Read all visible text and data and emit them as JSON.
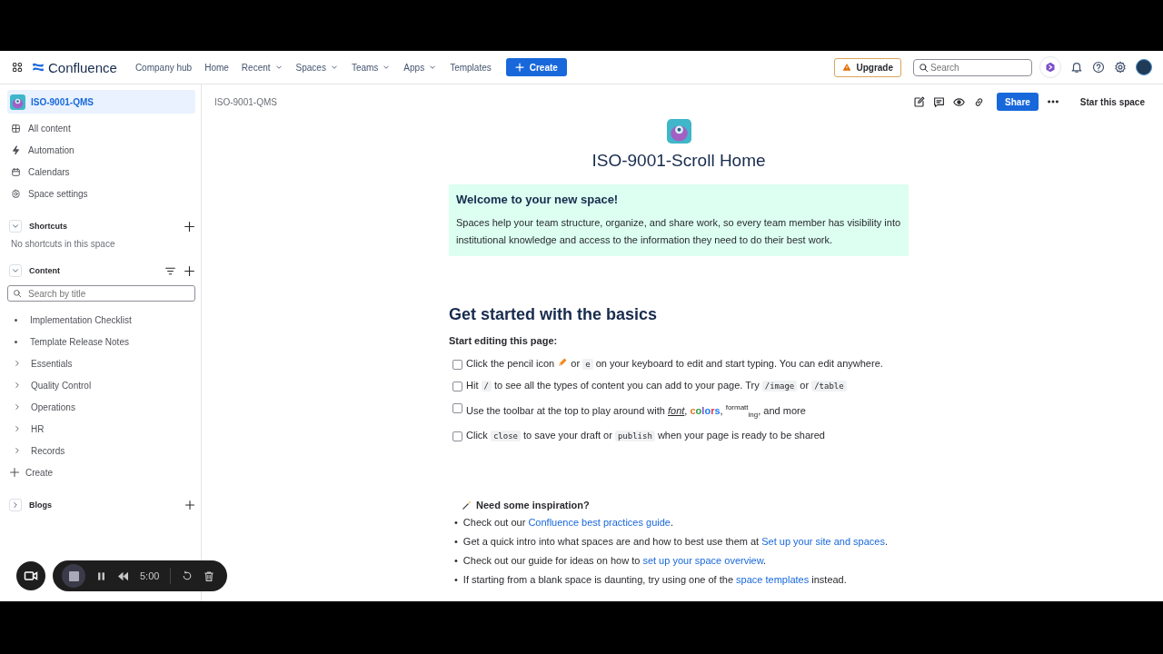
{
  "header": {
    "app_name": "Confluence",
    "nav": [
      {
        "label": "Company hub",
        "dropdown": false
      },
      {
        "label": "Home",
        "dropdown": false
      },
      {
        "label": "Recent",
        "dropdown": true
      },
      {
        "label": "Spaces",
        "dropdown": true
      },
      {
        "label": "Teams",
        "dropdown": true
      },
      {
        "label": "Apps",
        "dropdown": true
      },
      {
        "label": "Templates",
        "dropdown": false
      }
    ],
    "create_label": "Create",
    "upgrade_label": "Upgrade",
    "search_placeholder": "Search"
  },
  "sidebar": {
    "space_name": "ISO-9001-QMS",
    "items": [
      {
        "label": "All content",
        "kind": "grid"
      },
      {
        "label": "Automation",
        "kind": "bolt"
      },
      {
        "label": "Calendars",
        "kind": "calendar"
      },
      {
        "label": "Space settings",
        "kind": "gear"
      }
    ],
    "shortcuts": {
      "title": "Shortcuts",
      "expanded": true,
      "empty_text": "No shortcuts in this space"
    },
    "content": {
      "title": "Content",
      "expanded": true,
      "search_placeholder": "Search by title",
      "items": [
        {
          "label": "Implementation Checklist",
          "kind": "page"
        },
        {
          "label": "Template Release Notes",
          "kind": "page"
        },
        {
          "label": "Essentials",
          "kind": "folder"
        },
        {
          "label": "Quality Control",
          "kind": "folder"
        },
        {
          "label": "Operations",
          "kind": "folder"
        },
        {
          "label": "HR",
          "kind": "folder"
        },
        {
          "label": "Records",
          "kind": "folder"
        }
      ],
      "create_label": "Create"
    },
    "blogs": {
      "title": "Blogs",
      "expanded": false
    }
  },
  "page": {
    "breadcrumb": "ISO-9001-QMS",
    "share_label": "Share",
    "star_label": "Star this space",
    "title": "ISO-9001-Scroll Home",
    "welcome": {
      "title": "Welcome to your new space!",
      "body": "Spaces help your team structure, organize, and share work, so every team member has visibility into institutional knowledge and access to the information they need to do their best work."
    },
    "heading": "Get started with the basics",
    "subheading": "Start editing this page:",
    "tasks": [
      {
        "checked": false,
        "segments": [
          {
            "kind": "text",
            "text": "Click the pencil icon "
          },
          {
            "kind": "pencil"
          },
          {
            "kind": "text",
            "text": " or "
          },
          {
            "kind": "code",
            "text": "e"
          },
          {
            "kind": "text",
            "text": " on your keyboard to edit and start typing. You can edit anywhere."
          }
        ]
      },
      {
        "checked": false,
        "segments": [
          {
            "kind": "text",
            "text": "Hit "
          },
          {
            "kind": "code",
            "text": "/"
          },
          {
            "kind": "text",
            "text": " to see all the types of content you can add to your page. Try "
          },
          {
            "kind": "code",
            "text": "/image"
          },
          {
            "kind": "text",
            "text": " or "
          },
          {
            "kind": "code",
            "text": "/table"
          }
        ]
      },
      {
        "checked": false,
        "segments": [
          {
            "kind": "text",
            "text": "Use the toolbar at the top to play around with "
          },
          {
            "kind": "italic",
            "text": "font"
          },
          {
            "kind": "text",
            "text": ", "
          },
          {
            "kind": "rainbow",
            "text": "colors"
          },
          {
            "kind": "text",
            "text": ", "
          },
          {
            "kind": "sup",
            "text": "formatt"
          },
          {
            "kind": "sub",
            "text": "ing"
          },
          {
            "kind": "text",
            "text": ", and more"
          }
        ]
      },
      {
        "checked": false,
        "segments": [
          {
            "kind": "text",
            "text": "Click "
          },
          {
            "kind": "code",
            "text": "close"
          },
          {
            "kind": "text",
            "text": " to save your draft or "
          },
          {
            "kind": "code",
            "text": "publish"
          },
          {
            "kind": "text",
            "text": " when your page is ready to be shared"
          }
        ]
      }
    ],
    "inspiration_title": "Need some inspiration?",
    "bullets": [
      {
        "marker": "•",
        "segments": [
          {
            "kind": "text",
            "text": "Check out our "
          },
          {
            "kind": "link",
            "text": "Confluence best practices guide"
          },
          {
            "kind": "text",
            "text": "."
          }
        ]
      },
      {
        "marker": "•",
        "segments": [
          {
            "kind": "text",
            "text": "Get a quick intro into what spaces are and how to best use them at "
          },
          {
            "kind": "link",
            "text": "Set up your site and spaces"
          },
          {
            "kind": "text",
            "text": "."
          }
        ]
      },
      {
        "marker": "•",
        "segments": [
          {
            "kind": "text",
            "text": "Check out our guide for ideas on how to "
          },
          {
            "kind": "link",
            "text": "set up your space overview"
          },
          {
            "kind": "text",
            "text": "."
          }
        ]
      },
      {
        "marker": "•",
        "segments": [
          {
            "kind": "text",
            "text": "If starting from a blank space is daunting, try using one of the "
          },
          {
            "kind": "link",
            "text": "space templates"
          },
          {
            "kind": "text",
            "text": " instead."
          }
        ]
      }
    ]
  },
  "recorder": {
    "time": "5:00"
  }
}
